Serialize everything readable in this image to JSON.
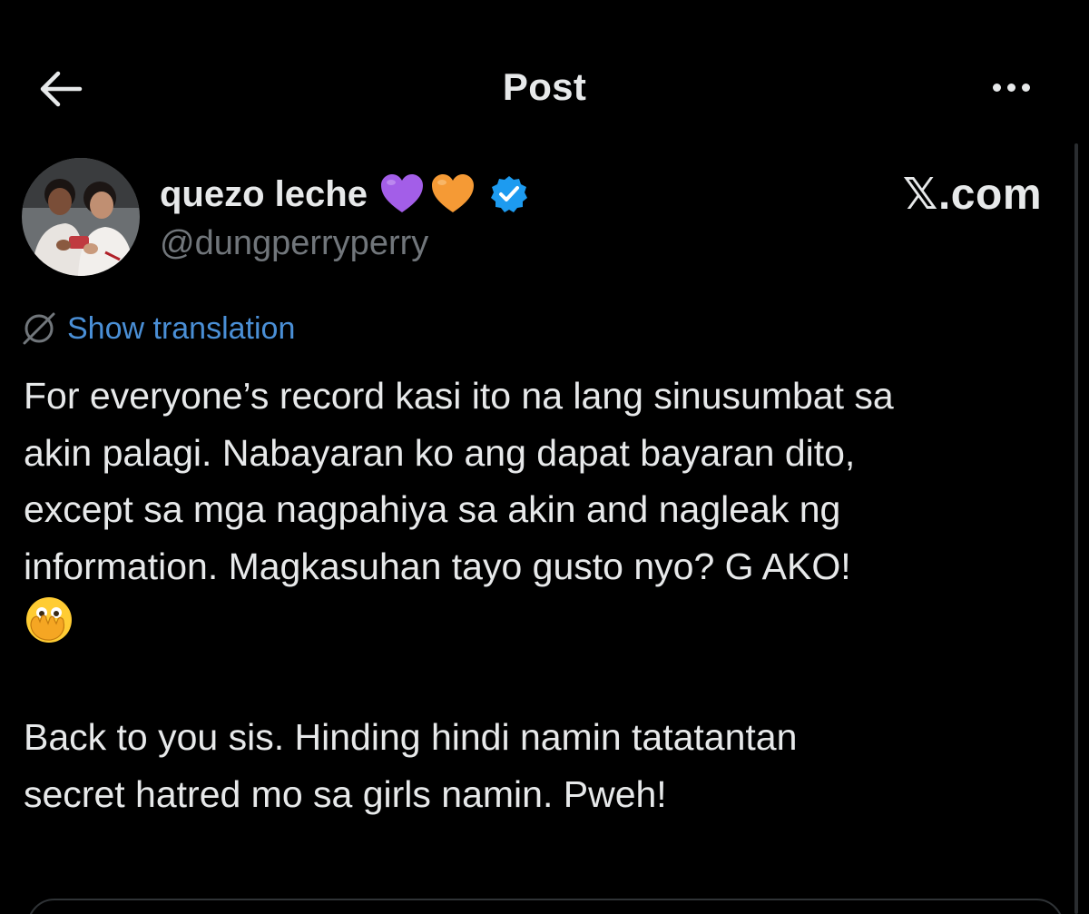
{
  "header": {
    "title": "Post",
    "back_icon": "arrow-left-icon",
    "more_icon": "more-horizontal-icon"
  },
  "author": {
    "display_name": "quezo leche",
    "handle": "@dungperryperry",
    "badges": [
      "purple-heart-icon",
      "orange-heart-icon",
      "verified-badge-icon"
    ],
    "verified_color": "#1d9bf0"
  },
  "brand": "𝕏.com",
  "translation": {
    "label": "Show translation",
    "icon": "globe-slash-icon"
  },
  "post": {
    "line1": "For everyone’s record kasi ito na lang sinusumbat sa",
    "line2": "akin palagi. Nabayaran ko ang dapat bayaran dito,",
    "line3": "except sa mga nagpahiya sa akin and nagleak ng",
    "line4": "information. Magkasuhan tayo gusto nyo? G AKO!",
    "emoji": "face-with-open-eyes-and-hand-over-mouth-icon",
    "line6": "Back to you sis. Hinding hindi namin tatatantan",
    "line7": "secret hatred mo sa girls namin. Pweh!"
  },
  "colors": {
    "background": "#000000",
    "text": "#e7e9ea",
    "secondary_text": "#71767b",
    "link": "#4a8fd6",
    "purple_heart": "#a35ee8",
    "orange_heart": "#f59a35"
  }
}
